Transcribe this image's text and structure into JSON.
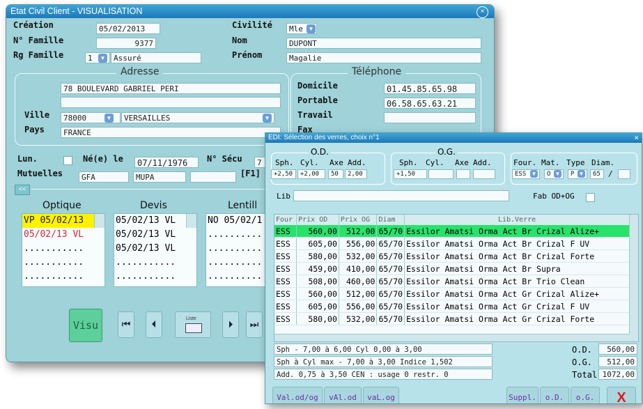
{
  "main": {
    "title": "Etat Civil Client - VISUALISATION",
    "close_icon": "×",
    "labels": {
      "creation": "Création",
      "civilite": "Civilité",
      "num_famille": "N° Famille",
      "nom": "Nom",
      "rg_famille": "Rg Famille",
      "prenom": "Prénom",
      "ville": "Ville",
      "pays": "Pays",
      "domicile": "Domicile",
      "portable": "Portable",
      "travail": "Travail",
      "fax": "Fax",
      "lun": "Lun.",
      "ne_le": "Né(e) le",
      "num_secu": "N° Sécu",
      "mutuelles": "Mutuelles",
      "f1": "[F1]"
    },
    "values": {
      "creation": "05/02/2013",
      "civilite": "Mle",
      "num_famille": "9377",
      "nom": "DUPONT",
      "rg_famille": "1",
      "assure": "Assuré",
      "prenom": "Magalie",
      "adresse1": "78 BOULEVARD GABRIEL PERI",
      "adresse2": "",
      "cp": "78000",
      "ville": "VERSAILLES",
      "pays": "FRANCE",
      "domicile": "01.45.85.65.98",
      "portable": "06.58.65.63.21",
      "travail": "",
      "fax": "",
      "ne_le": "07/11/1976",
      "secu": "7",
      "mut1": "GFA",
      "mut2": "MUPA",
      "mut3": ""
    },
    "groups": {
      "adresse": "Adresse",
      "telephone": "Téléphone"
    },
    "collapse": "<<",
    "cols": {
      "optique": "Optique",
      "devis": "Devis",
      "lentilles": "Lentill"
    },
    "optique": [
      "VP 05/02/13",
      "05/02/13 VL",
      "...........",
      "...........",
      "..........."
    ],
    "devis": [
      "05/02/13 VL",
      "05/02/13 VL",
      "05/02/13 VL",
      "...........",
      "..........."
    ],
    "lentilles": [
      "NO 05/02/1",
      "..........",
      "..........",
      "..........",
      ".........."
    ],
    "visu_button": "Visu",
    "liste_label": "Liste"
  },
  "verres": {
    "title": "EDI: Sélection des verres, choix n°1",
    "close_icon": "×",
    "od": {
      "title": "O.D.",
      "sph_label": "Sph.",
      "cyl_label": "Cyl.",
      "axe_label": "Axe",
      "add_label": "Add.",
      "sph": "+2,50",
      "cyl": "+2,00",
      "axe": "50",
      "add": "2,00"
    },
    "og": {
      "title": "O.G.",
      "sph_label": "Sph.",
      "cyl_label": "Cyl.",
      "axe_label": "Axe",
      "add_label": "Add.",
      "sph": "+1,50",
      "cyl": "",
      "axe": "",
      "add": ""
    },
    "four_label": "Four.",
    "mat_label": "Mat.",
    "type_label": "Type",
    "diam_label": "Diam.",
    "four": "ESS",
    "mat": "O",
    "type": "P",
    "diam": "65",
    "diam_sep": "/",
    "lib_label": "Lib",
    "fab_label": "Fab OD+OG",
    "headers": [
      "Four",
      "Prix OD",
      "Prix OG",
      "Diam",
      "Lib.Verre"
    ],
    "rows": [
      [
        "ESS",
        "560,00",
        "512,00",
        "65/70",
        "Essilor Amatsi Orma Act Br Crizal Alize+"
      ],
      [
        "ESS",
        "605,00",
        "556,00",
        "65/70",
        "Essilor Amatsi Orma Act Br Crizal F UV"
      ],
      [
        "ESS",
        "580,00",
        "532,00",
        "65/70",
        "Essilor Amatsi Orma Act Br Crizal Forte"
      ],
      [
        "ESS",
        "459,00",
        "410,00",
        "65/70",
        "Essilor Amatsi Orma Act Br Supra"
      ],
      [
        "ESS",
        "508,00",
        "460,00",
        "65/70",
        "Essilor Amatsi Orma Act Br Trio Clean"
      ],
      [
        "ESS",
        "560,00",
        "512,00",
        "65/70",
        "Essilor Amatsi Orma Act Gr Crizal Alize+"
      ],
      [
        "ESS",
        "605,00",
        "556,00",
        "65/70",
        "Essilor Amatsi Orma Act Gr Crizal F UV"
      ],
      [
        "ESS",
        "580,00",
        "532,00",
        "65/70",
        "Essilor Amatsi Orma Act Gr Crizal Forte"
      ]
    ],
    "info1": "Sph - 7,00 à   6,00 Cyl   0,00 à   3,00",
    "info2": "Sph à Cyl max - 7,00 à   3,00  Indice 1,502",
    "info3": "Add.  0,75 à  3,50  CEN : usage 0 restr. 0",
    "tot_od_label": "O.D.",
    "tot_og_label": "O.G.",
    "total_label": "Total",
    "tot_od": "560,00",
    "tot_og": "512,00",
    "total": "1072,00",
    "buttons": {
      "val_odog": "Val.od/og",
      "val_od": "vAl.od",
      "val_og": "vaL.og",
      "suppl": "Suppl.",
      "od": "o.D.",
      "og": "o.G.",
      "cancel": "X"
    }
  }
}
